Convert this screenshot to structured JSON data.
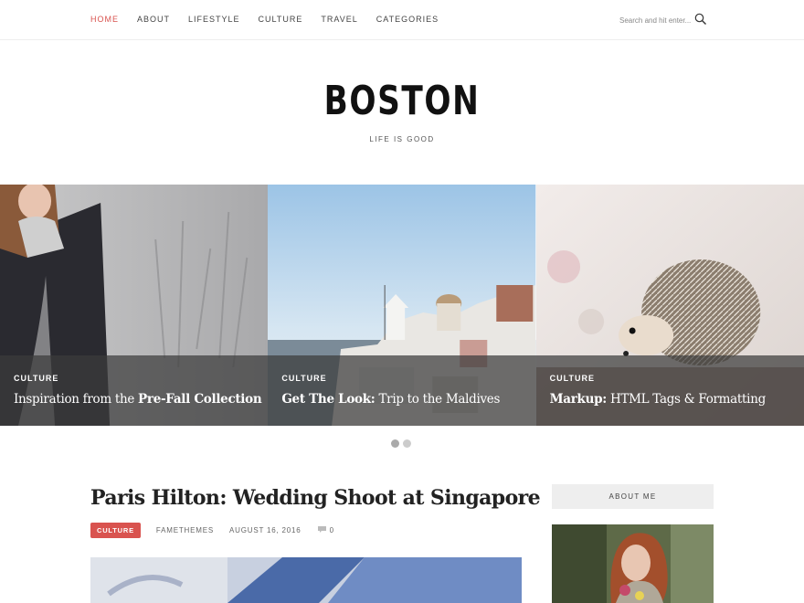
{
  "nav": {
    "items": [
      "HOME",
      "ABOUT",
      "LIFESTYLE",
      "CULTURE",
      "TRAVEL",
      "CATEGORIES"
    ],
    "active": "HOME"
  },
  "search": {
    "placeholder": "Search and hit enter..."
  },
  "site": {
    "title": "BOSTON",
    "tagline": "LIFE IS GOOD"
  },
  "slides": [
    {
      "category": "CULTURE",
      "title_plain": "Inspiration from the ",
      "title_bold": "Pre-Fall Collection",
      "bold_first": false
    },
    {
      "category": "CULTURE",
      "title_bold": "Get The Look:",
      "title_plain": " Trip to the Maldives",
      "bold_first": true
    },
    {
      "category": "CULTURE",
      "title_bold": "Markup:",
      "title_plain": " HTML Tags & Formatting",
      "bold_first": true
    }
  ],
  "slider": {
    "pages": 2,
    "current": 1
  },
  "post": {
    "title_bold": "Paris Hilton:",
    "title_plain": " Wedding Shoot at Singapore",
    "category": "CULTURE",
    "author": "FAMETHEMES",
    "date": "AUGUST 16, 2016",
    "comments": "0"
  },
  "sidebar": {
    "widget_title": "ABOUT ME"
  },
  "colors": {
    "accent": "#d9534f",
    "caption_overlay": "#3c3c3c",
    "widget_bg": "#eeeeee"
  }
}
